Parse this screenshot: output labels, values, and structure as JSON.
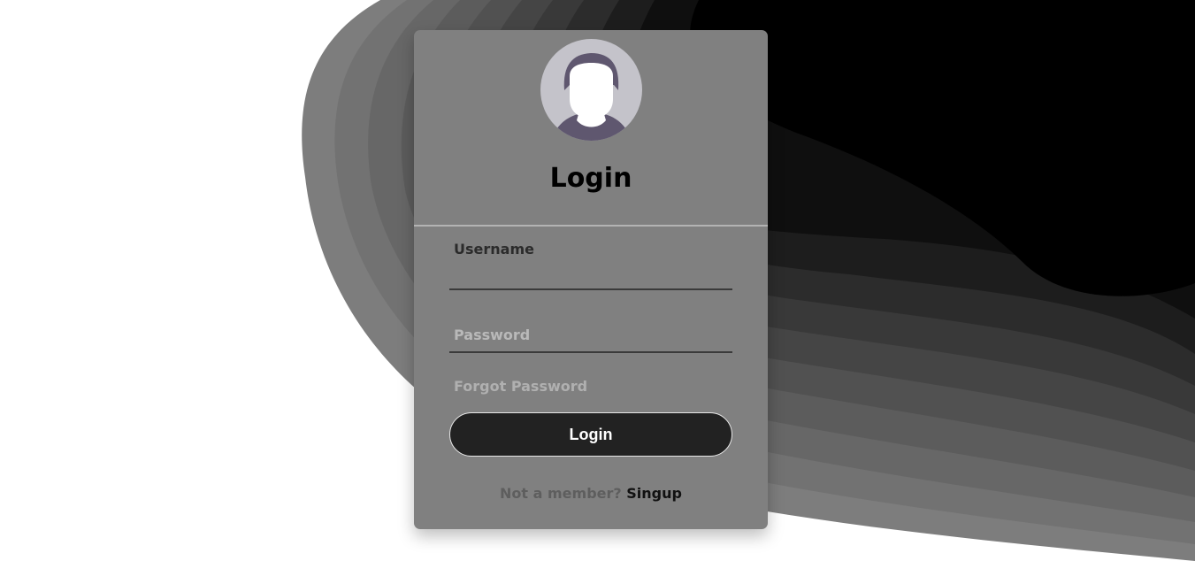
{
  "login_card": {
    "title": "Login",
    "username_label": "Username",
    "password_placeholder": "Password",
    "forgot_password": "Forgot Password",
    "login_button": "Login",
    "signup_prompt": "Not a member?",
    "signup_link": "Singup"
  },
  "colors": {
    "card": "#808080",
    "button": "#222222",
    "avatar_bg": "#c4c3ca",
    "avatar_shirt_hair": "#5f576f"
  },
  "icons": {
    "avatar": "user-avatar-icon"
  }
}
